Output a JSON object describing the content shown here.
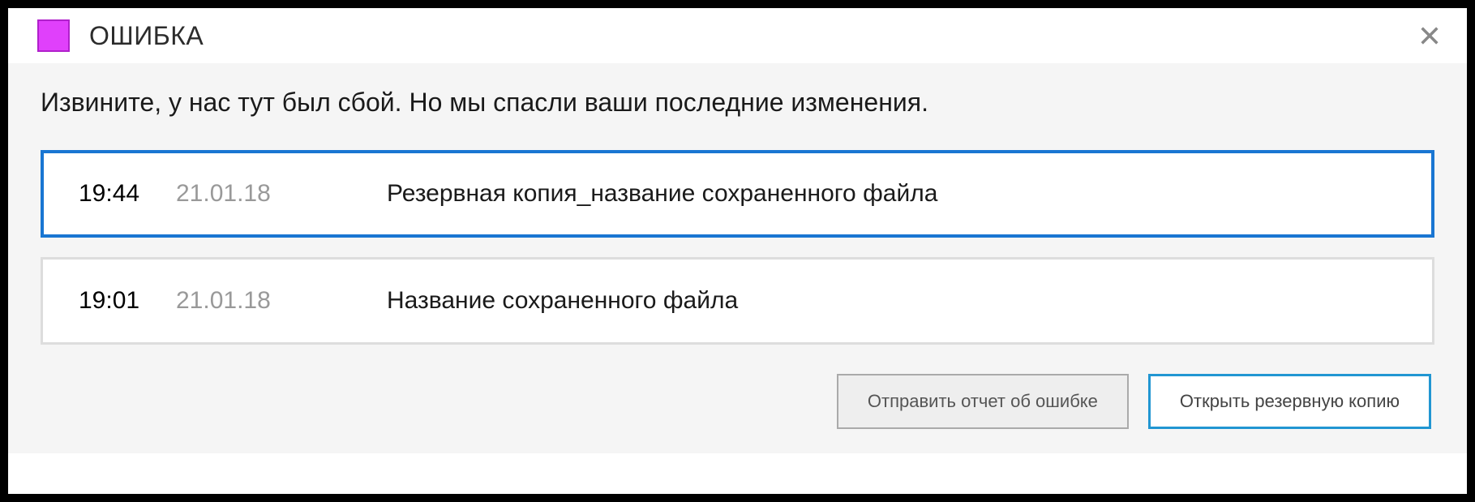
{
  "colors": {
    "accent_magenta": "#e040fb",
    "accent_blue": "#1976d2"
  },
  "header": {
    "title": "ОШИБКА"
  },
  "message": "Извините, у нас тут был сбой. Но мы спасли ваши последние изменения.",
  "backups": [
    {
      "time": "19:44",
      "date": "21.01.18",
      "name": "Резервная копия_название сохраненного файла",
      "selected": true
    },
    {
      "time": "19:01",
      "date": "21.01.18",
      "name": "Название сохраненного файла",
      "selected": false
    }
  ],
  "buttons": {
    "send_report": "Отправить отчет об ошибке",
    "open_backup": "Открыть резервную копию"
  }
}
